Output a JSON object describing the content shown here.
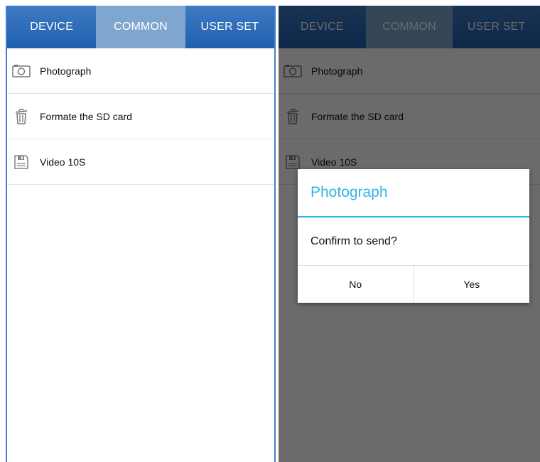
{
  "tabs": [
    {
      "label": "DEVICE",
      "active": false
    },
    {
      "label": "COMMON",
      "active": true
    },
    {
      "label": "USER SET",
      "active": false
    }
  ],
  "list_items": [
    {
      "label": "Photograph",
      "icon": "camera-icon"
    },
    {
      "label": "Formate the SD card",
      "icon": "trash-icon"
    },
    {
      "label": "Video 10S",
      "icon": "floppy-disk-icon"
    }
  ],
  "dialog": {
    "title": "Photograph",
    "message": "Confirm to send?",
    "no_label": "No",
    "yes_label": "Yes"
  },
  "colors": {
    "tabbar": "#2a6cb8",
    "active_tab": "#7fa6cf",
    "dialog_accent": "#33b5e5"
  }
}
